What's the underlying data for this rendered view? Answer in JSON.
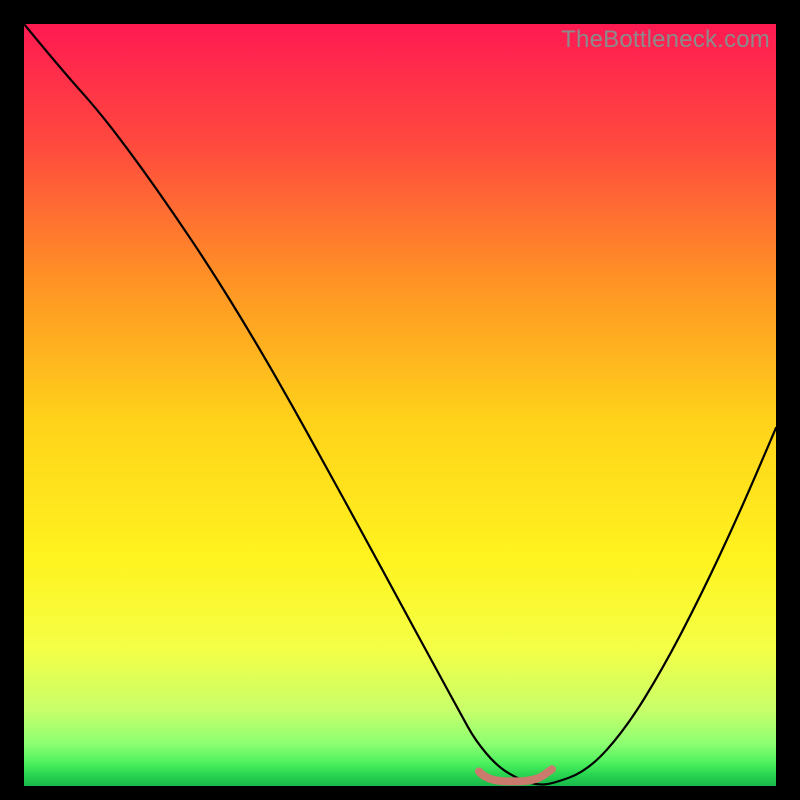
{
  "watermark": "TheBottleneck.com",
  "chart_data": {
    "type": "line",
    "title": "",
    "xlabel": "",
    "ylabel": "",
    "xlim": [
      0,
      100
    ],
    "ylim": [
      0,
      100
    ],
    "grid": false,
    "series": [
      {
        "name": "bottleneck-curve",
        "x": [
          0,
          5,
          10,
          15,
          20,
          25,
          30,
          35,
          40,
          45,
          50,
          55,
          58,
          60,
          63,
          66,
          68,
          70,
          75,
          80,
          85,
          90,
          95,
          100
        ],
        "y": [
          100,
          94,
          88.5,
          82,
          75,
          67.6,
          59.6,
          51.1,
          42.2,
          33.2,
          24.1,
          15,
          9.6,
          6,
          2.5,
          0.8,
          0.2,
          0.2,
          2,
          7.5,
          15.5,
          25,
          35.5,
          47
        ]
      },
      {
        "name": "flat-valley-marker",
        "x": [
          60.5,
          61,
          62,
          63,
          64,
          65,
          66,
          67,
          68,
          68.8,
          69.5,
          70.2
        ],
        "y": [
          1.9,
          1.4,
          0.9,
          0.7,
          0.6,
          0.6,
          0.6,
          0.7,
          0.9,
          1.2,
          1.7,
          2.2
        ]
      }
    ],
    "gradient_stops": [
      {
        "offset": 0.0,
        "color": "#ff1a52"
      },
      {
        "offset": 0.16,
        "color": "#ff4a3e"
      },
      {
        "offset": 0.34,
        "color": "#ff9425"
      },
      {
        "offset": 0.52,
        "color": "#ffd21a"
      },
      {
        "offset": 0.7,
        "color": "#fff31f"
      },
      {
        "offset": 0.82,
        "color": "#f4ff46"
      },
      {
        "offset": 0.9,
        "color": "#c8ff6a"
      },
      {
        "offset": 0.945,
        "color": "#8cff72"
      },
      {
        "offset": 0.97,
        "color": "#4cf05e"
      },
      {
        "offset": 0.985,
        "color": "#29d651"
      },
      {
        "offset": 1.0,
        "color": "#18b84a"
      }
    ],
    "marker_color": "#cb7a6e",
    "curve_color": "#000000"
  }
}
